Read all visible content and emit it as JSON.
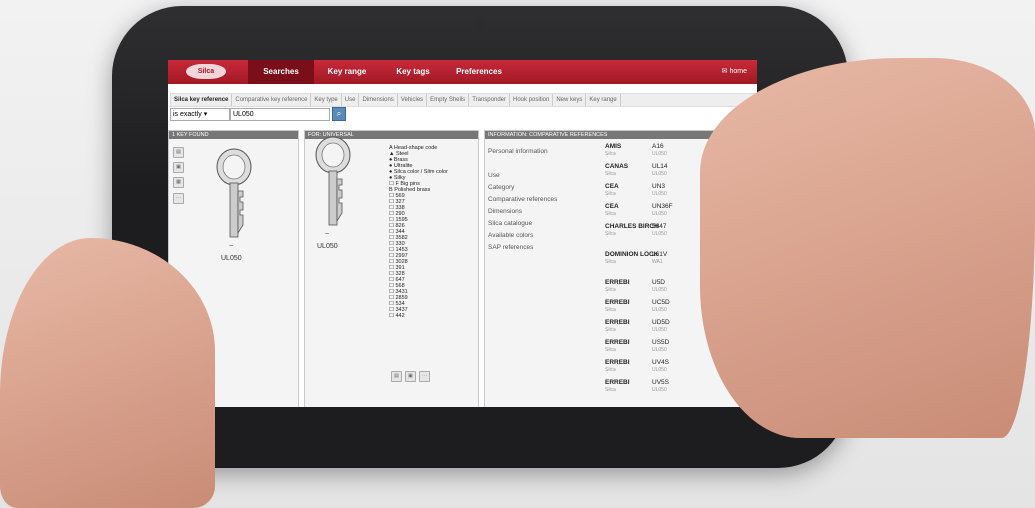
{
  "nav": {
    "tabs": [
      {
        "label": "Searches"
      },
      {
        "label": "Key range"
      },
      {
        "label": "Key tags"
      },
      {
        "label": "Preferences"
      }
    ],
    "home_label": "home"
  },
  "subtabs": [
    "Silca key reference",
    "Comparative key reference",
    "Key type",
    "Use",
    "Dimensions",
    "Vehicles",
    "Empty Shells",
    "Transponder",
    "Hook position",
    "New keys",
    "Key range"
  ],
  "search": {
    "operator": "is exactly",
    "value": "UL050"
  },
  "panel1": {
    "header": "1 KEY FOUND",
    "key_name": "UL050"
  },
  "panel2": {
    "header": "FOR: UNIVERSAL",
    "key_name": "UL050",
    "attributes": [
      "A Head-shape code",
      "▲ Steel",
      "● Brass",
      "● Ultralite",
      "● Silca color / Slim color",
      "● Silky",
      "☐ F Big pins",
      "B Polished brass",
      "☐ 569",
      "☐ 327",
      "☐ 338",
      "☐ 290",
      "☐ 1595",
      "☐ 826",
      "☐ 344",
      "☐ 3582",
      "☐ 330",
      "☐ 1453",
      "☐ 2997",
      "☐ 3028",
      "☐ 391",
      "☐ 328",
      "☐ 647",
      "☐ 568",
      "☐ 3431",
      "☐ 2859",
      "☐ 534",
      "☐ 3437",
      "☐ 442"
    ]
  },
  "panel3": {
    "header": "INFORMATION: COMPARATIVE REFERENCES",
    "left_items": [
      "Personal information",
      "",
      "Use",
      "Category",
      "Comparative references",
      "Dimensions",
      "Silca catalogue",
      "Available colors",
      "SAP references"
    ],
    "refs": [
      {
        "brand": "AMIS",
        "sub": "Silca",
        "code": "A16",
        "codesub": "UL050"
      },
      {
        "brand": "CANAS",
        "sub": "Silca",
        "code": "UL14",
        "codesub": "UL050"
      },
      {
        "brand": "CEA",
        "sub": "Silca",
        "code": "UN3",
        "codesub": "UL050"
      },
      {
        "brand": "CEA",
        "sub": "Silca",
        "code": "UN36F",
        "codesub": "UL050"
      },
      {
        "brand": "CHARLES BIRCH",
        "sub": "Silca",
        "code": "5847",
        "codesub": "UL050"
      },
      {
        "brand": "DOMINION LOCK",
        "sub": "Silca",
        "code": "L61V",
        "codesub": "WA1"
      },
      {
        "brand": "ERREBI",
        "sub": "Silca",
        "code": "U5D",
        "codesub": "UL050"
      },
      {
        "brand": "ERREBI",
        "sub": "Silca",
        "code": "UC5D",
        "codesub": "UL050"
      },
      {
        "brand": "ERREBI",
        "sub": "Silca",
        "code": "UD5D",
        "codesub": "UL050"
      },
      {
        "brand": "ERREBI",
        "sub": "Silca",
        "code": "US5D",
        "codesub": "UL050"
      },
      {
        "brand": "ERREBI",
        "sub": "Silca",
        "code": "UV4S",
        "codesub": "UL050"
      },
      {
        "brand": "ERREBI",
        "sub": "Silca",
        "code": "UV5S",
        "codesub": "UL050"
      }
    ]
  }
}
